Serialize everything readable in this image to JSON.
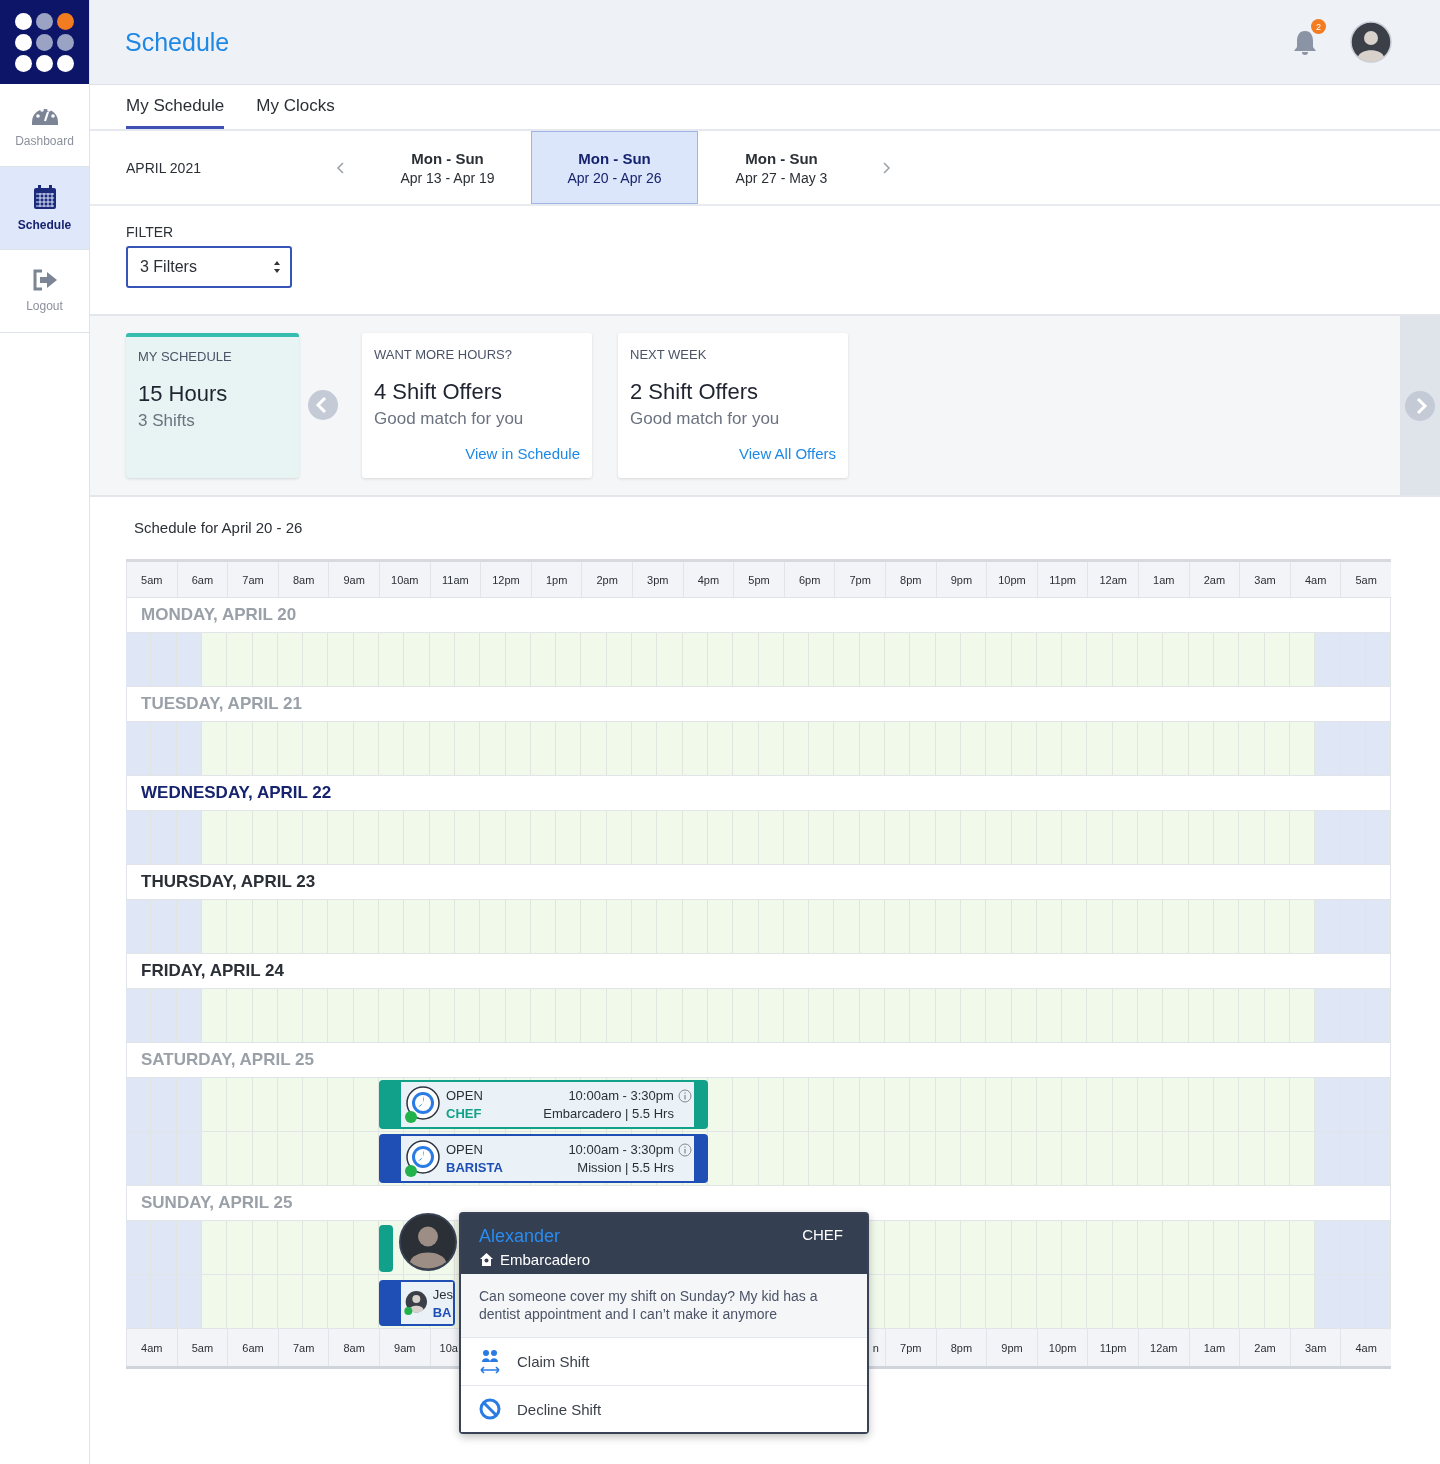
{
  "header": {
    "title": "Schedule",
    "notification_count": "2"
  },
  "sidebar": {
    "items": [
      {
        "label": "Dashboard",
        "selected": false
      },
      {
        "label": "Schedule",
        "selected": true
      },
      {
        "label": "Logout",
        "selected": false
      }
    ]
  },
  "tabs": [
    {
      "label": "My Schedule",
      "selected": true
    },
    {
      "label": "My Clocks",
      "selected": false
    }
  ],
  "month": "APRIL 2021",
  "weeks": [
    {
      "days": "Mon - Sun",
      "range": "Apr 13 - Apr 19",
      "selected": false
    },
    {
      "days": "Mon - Sun",
      "range": "Apr 20 - Apr 26",
      "selected": true
    },
    {
      "days": "Mon - Sun",
      "range": "Apr 27 - May 3",
      "selected": false
    }
  ],
  "filter": {
    "label": "FILTER",
    "value": "3 Filters"
  },
  "cards": [
    {
      "kind": "summary",
      "heading": "MY SCHEDULE",
      "title": "15 Hours",
      "subtitle": "3 Shifts"
    },
    {
      "kind": "offer",
      "heading": "WANT MORE HOURS?",
      "title": "4 Shift Offers",
      "subtitle": "Good match for you",
      "link": "View in Schedule"
    },
    {
      "kind": "offer",
      "heading": "NEXT WEEK",
      "title": "2 Shift Offers",
      "subtitle": "Good match for you",
      "link": "View All Offers"
    }
  ],
  "schedule": {
    "title": "Schedule for April 20 - 26",
    "hours": [
      "5am",
      "6am",
      "7am",
      "8am",
      "9am",
      "10am",
      "11am",
      "12pm",
      "1pm",
      "2pm",
      "3pm",
      "4pm",
      "5pm",
      "6pm",
      "7pm",
      "8pm",
      "9pm",
      "10pm",
      "11pm",
      "12am",
      "1am",
      "2am",
      "3am",
      "4am",
      "5am"
    ],
    "days": [
      {
        "label": "MONDAY, APRIL 20",
        "kind": "past"
      },
      {
        "label": "TUESDAY, APRIL 21",
        "kind": "past"
      },
      {
        "label": "WEDNESDAY, APRIL 22",
        "kind": "today"
      },
      {
        "label": "THURSDAY, APRIL 23",
        "kind": "future"
      },
      {
        "label": "FRIDAY, APRIL 24",
        "kind": "future"
      },
      {
        "label": "SATURDAY, APRIL 25",
        "kind": "past",
        "shifts": [
          {
            "kind": "open",
            "color": "#11a08a",
            "status": "OPEN",
            "role": "CHEF",
            "time": "10:00am - 3:30pm",
            "detail": "Embarcadero  |  5.5 Hrs"
          },
          {
            "kind": "open",
            "color": "#1f4fb5",
            "status": "OPEN",
            "role": "BARISTA",
            "time": "10:00am - 3:30pm",
            "detail": "Mission  |  5.5 Hrs"
          }
        ]
      },
      {
        "label": "SUNDAY, APRIL 25",
        "kind": "past",
        "shifts": [
          {
            "kind": "covered",
            "color": "#11a08a"
          },
          {
            "kind": "person",
            "color": "#1f4fb5",
            "name": "Jes",
            "role": "BA"
          }
        ]
      }
    ],
    "bottom_axis": {
      "left": [
        "4am",
        "5am",
        "6am",
        "7am",
        "8am",
        "9am",
        "10a"
      ],
      "right": [
        "n",
        "7pm",
        "8pm",
        "9pm",
        "10pm",
        "11pm",
        "12am",
        "1am",
        "2am",
        "3am",
        "4am"
      ]
    }
  },
  "popup": {
    "name": "Alexander",
    "role": "CHEF",
    "location": "Embarcadero",
    "message": "Can someone cover my shift on Sunday? My kid has a dentist appointment and I can’t make it anymore",
    "actions": [
      {
        "label": "Claim Shift",
        "kind": "claim"
      },
      {
        "label": "Decline Shift",
        "kind": "decline"
      }
    ]
  }
}
